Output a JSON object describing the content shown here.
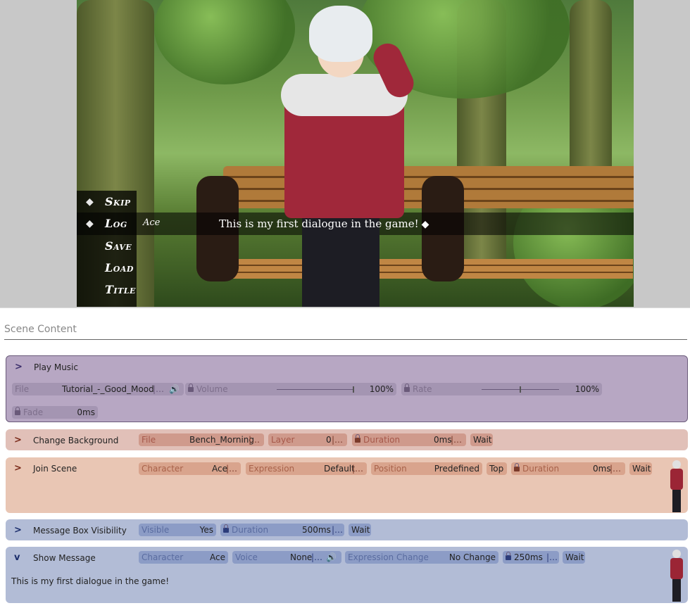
{
  "game": {
    "menu": [
      {
        "label": "Skip",
        "has_marker": true
      },
      {
        "label": "Log",
        "has_marker": true
      },
      {
        "label": "Save",
        "has_marker": false
      },
      {
        "label": "Load",
        "has_marker": false
      },
      {
        "label": "Title",
        "has_marker": false
      }
    ],
    "speaker": "Ace",
    "dialogue": "This is my first dialogue in the game!"
  },
  "panel": {
    "section_title": "Scene Content",
    "commands": {
      "play_music": {
        "title": "Play Music",
        "file_label": "File",
        "file_value": "Tutorial_-_Good_Mood",
        "volume_label": "Volume",
        "volume_value": "100%",
        "rate_label": "Rate",
        "rate_value": "100%",
        "fade_label": "Fade",
        "fade_value": "0ms"
      },
      "change_background": {
        "title": "Change Background",
        "file_label": "File",
        "file_value": "Bench_Morning",
        "layer_label": "Layer",
        "layer_value": "0",
        "duration_label": "Duration",
        "duration_value": "0ms",
        "wait_label": "Wait"
      },
      "join_scene": {
        "title": "Join Scene",
        "character_label": "Character",
        "character_value": "Ace",
        "expression_label": "Expression",
        "expression_value": "Default",
        "position_label": "Position",
        "position_value": "Predefined",
        "top_label": "Top",
        "duration_label": "Duration",
        "duration_value": "0ms",
        "wait_label": "Wait"
      },
      "message_box_visibility": {
        "title": "Message Box Visibility",
        "visible_label": "Visible",
        "visible_value": "Yes",
        "duration_label": "Duration",
        "duration_value": "500ms",
        "wait_label": "Wait"
      },
      "show_message": {
        "title": "Show Message",
        "character_label": "Character",
        "character_value": "Ace",
        "voice_label": "Voice",
        "voice_value": "None",
        "expression_change_label": "Expression Change",
        "expression_change_value": "No Change",
        "duration_value": "250ms",
        "wait_label": "Wait",
        "body": "This is my first dialogue in the game!"
      }
    }
  },
  "colors": {
    "music_bg": "#b7a7c3",
    "background_bg": "#e1c0b8",
    "join_bg": "#e9c6b4",
    "message_bg": "#b2bcd6"
  }
}
